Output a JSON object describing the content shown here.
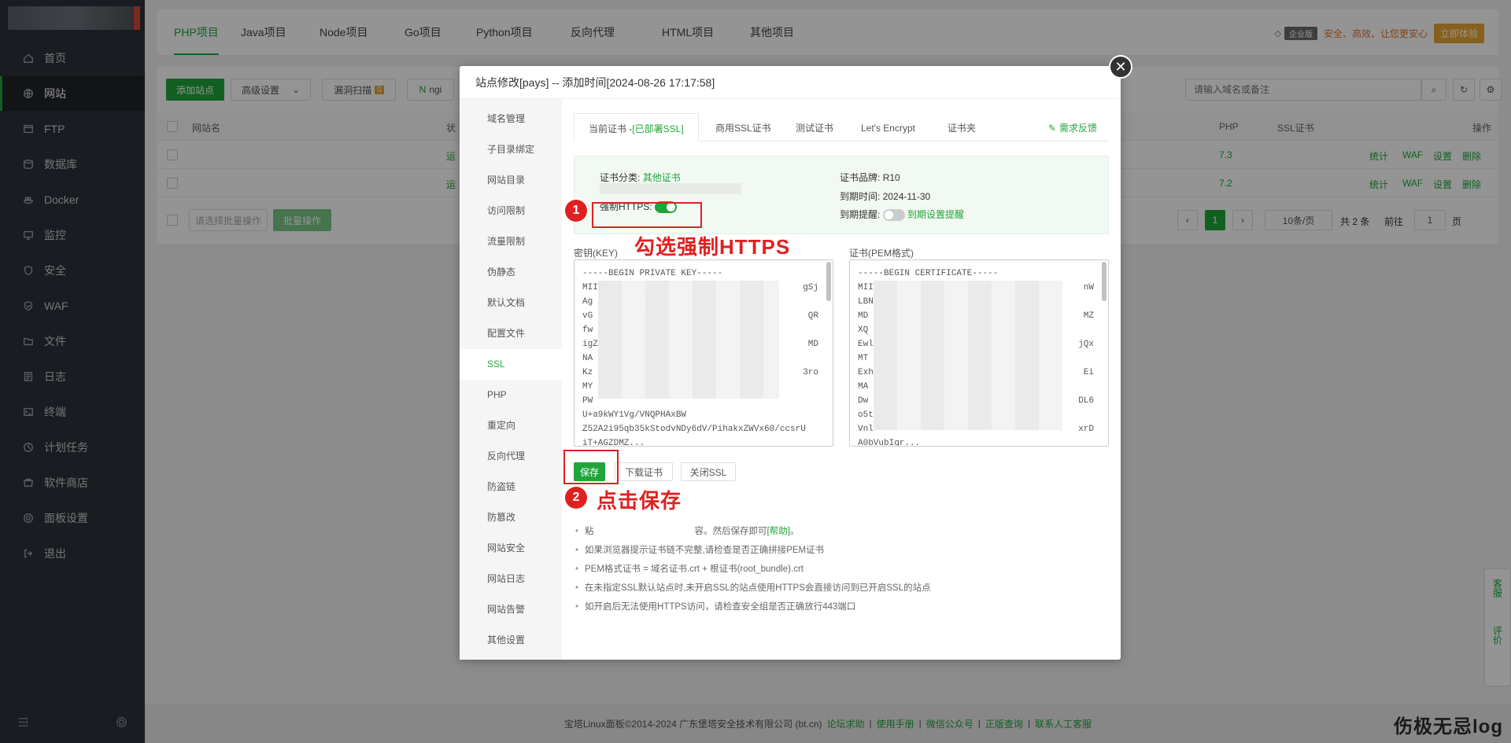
{
  "sidebar": {
    "items": [
      {
        "label": "首页",
        "icon": "home-icon"
      },
      {
        "label": "网站",
        "icon": "globe-icon"
      },
      {
        "label": "FTP",
        "icon": "ftp-icon"
      },
      {
        "label": "数据库",
        "icon": "database-icon"
      },
      {
        "label": "Docker",
        "icon": "docker-icon"
      },
      {
        "label": "监控",
        "icon": "monitor-icon"
      },
      {
        "label": "安全",
        "icon": "shield-icon"
      },
      {
        "label": "WAF",
        "icon": "waf-icon"
      },
      {
        "label": "文件",
        "icon": "folder-icon"
      },
      {
        "label": "日志",
        "icon": "log-icon"
      },
      {
        "label": "终端",
        "icon": "terminal-icon"
      },
      {
        "label": "计划任务",
        "icon": "clock-icon"
      },
      {
        "label": "软件商店",
        "icon": "store-icon"
      },
      {
        "label": "面板设置",
        "icon": "gear-icon"
      },
      {
        "label": "退出",
        "icon": "logout-icon"
      }
    ],
    "active_index": 1
  },
  "topbar": {
    "tabs": [
      "PHP项目",
      "Java项目",
      "Node项目",
      "Go项目",
      "Python项目",
      "反向代理",
      "HTML项目",
      "其他项目"
    ],
    "vip_label": "企业版",
    "tagline": "安全、高效、让您更安心",
    "trial_button": "立即体验"
  },
  "toolbar": {
    "add_site": "添加站点",
    "advanced": "高级设置",
    "vuln_scan": "漏洞扫描",
    "vuln_count": "0",
    "nginx": "ngi",
    "search_placeholder": "请输入域名或备注"
  },
  "table": {
    "headers": {
      "name": "网站名",
      "status": "状",
      "php": "PHP",
      "ssl": "SSL证书",
      "ops": "操作"
    },
    "rows": [
      {
        "php": "7.3",
        "status": "运",
        "ops": [
          "统计",
          "WAF",
          "设置",
          "删除"
        ]
      },
      {
        "php": "7.2",
        "status": "运",
        "ops": [
          "统计",
          "WAF",
          "设置",
          "删除"
        ]
      }
    ],
    "batch_placeholder": "请选择批量操作",
    "batch_button": "批量操作",
    "page": "1",
    "page_size": "10条/页",
    "total": "共 2 条",
    "goto_label": "前往",
    "goto_value": "1",
    "page_unit": "页"
  },
  "modal": {
    "title": "站点修改[pays] -- 添加时间[2024-08-26 17:17:58]",
    "nav": [
      "域名管理",
      "子目录绑定",
      "网站目录",
      "访问限制",
      "流量限制",
      "伪静态",
      "默认文档",
      "配置文件",
      "SSL",
      "PHP",
      "重定向",
      "反向代理",
      "防盗链",
      "防篡改",
      "网站安全",
      "网站日志",
      "网站告警",
      "其他设置"
    ],
    "nav_active": 8,
    "ssl_tabs": {
      "current_prefix": "当前证书 -",
      "current_status": "[已部署SSL]",
      "commercial": "商用SSL证书",
      "test": "测试证书",
      "letsencrypt": "Let's Encrypt",
      "cert_folder": "证书夹",
      "feedback": "需求反馈"
    },
    "cert_info": {
      "category_label": "证书分类:",
      "category_value": "其他证书",
      "brand_label": "证书品牌:",
      "brand_value": "R10",
      "expire_label": "到期时间:",
      "expire_value": "2024-11-30",
      "remind_label": "到期提醒:",
      "remind_link": "到期设置提醒",
      "force_https_label": "强制HTTPS:"
    },
    "key_label": "密钥(KEY)",
    "cert_label": "证书(PEM格式)",
    "key_lines": [
      "-----BEGIN PRIVATE KEY-----",
      "MIIE",
      "Ag",
      "vG",
      "fw",
      "igZ",
      "NA",
      "Kz",
      "MY",
      "PW",
      "U+a9kWY1Vg/VNQPHAxBW",
      "Z52A2i95qb35kStodvNDy6dV/PihakxZWVx60/ccsrU",
      "iT+AGZDMZ..."
    ],
    "key_right_frags": [
      "gSj",
      "QR",
      "MD",
      "3ro"
    ],
    "cert_lines": [
      "-----BEGIN CERTIFICATE-----",
      "MII",
      "LBN",
      "MD",
      "XQ",
      "Ewl",
      "MT",
      "Exh",
      "MA",
      "Dw",
      "o5t",
      "Vnl",
      "A0bVubIgr..."
    ],
    "cert_right_frags": [
      "nW",
      "MZ",
      "jQx",
      "Ei",
      "DL6",
      "xrD"
    ],
    "buttons": {
      "save": "保存",
      "download": "下载证书",
      "close_ssl": "关闭SSL"
    },
    "notes": [
      "粘贴您的*.key以及*.pem内容，然后保存即可[帮助]。",
      "如果浏览器提示证书链不完整,请检查是否正确拼接PEM证书",
      "PEM格式证书 = 域名证书.crt + 根证书(root_bundle).crt",
      "在未指定SSL默认站点时,未开启SSL的站点使用HTTPS会直接访问到已开启SSL的站点",
      "如开启后无法使用HTTPS访问，请检查安全组是否正确放行443端口"
    ],
    "note1_suffix": "容。然后保存即可",
    "note1_help": "[帮助]",
    "note1_prefix": "粘"
  },
  "annotations": {
    "step1_num": "1",
    "step1_text": "勾选强制HTTPS",
    "step2_num": "2",
    "step2_text": "点击保存"
  },
  "footer": {
    "copyright": "宝塔Linux面板©2014-2024 广东堡塔安全技术有限公司 (bt.cn)",
    "links": [
      "论坛求助",
      "使用手册",
      "微信公众号",
      "正版查询",
      "联系人工客服"
    ]
  },
  "side_float": {
    "service": "客服",
    "rate": "评价"
  },
  "watermark": "伤极无忌log",
  "colors": {
    "accent": "#20a53a",
    "annotation": "#e02020",
    "sidebar_bg": "#2c3138"
  }
}
